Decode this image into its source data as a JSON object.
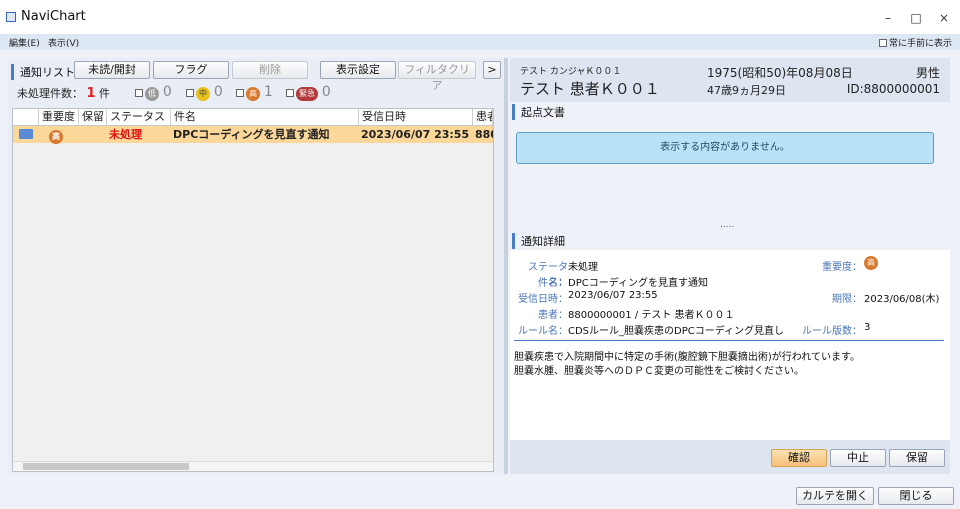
{
  "window": {
    "title": "NaviChart",
    "minimize": "–",
    "maximize": "□",
    "close": "×"
  },
  "menu": {
    "items": [
      "編集(E)",
      "表示(V)"
    ],
    "always_on_top": "常に手前に表示"
  },
  "left": {
    "title": "通知リスト",
    "buttons": {
      "unread": "未読/開封",
      "flag": "フラグ",
      "delete": "削除",
      "display_settings": "表示設定",
      "filter_clear": "フィルタクリア",
      "expand": ">"
    },
    "unprocessed_label": "未処理件数：",
    "unprocessed_count": "1",
    "unprocessed_unit": "件",
    "filters": [
      {
        "badge": "低",
        "count": "0",
        "color": "#9a9a9a"
      },
      {
        "badge": "中",
        "count": "0",
        "color": "#e8c21a"
      },
      {
        "badge": "高",
        "count": "1",
        "color": "#d9782c"
      },
      {
        "badge": "緊急",
        "count": "0",
        "color": "#b33a3a"
      }
    ],
    "columns": [
      "重要度",
      "保留",
      "ステータス",
      "件名",
      "受信日時",
      "患者"
    ],
    "rows": [
      {
        "importance": "高",
        "hold": "",
        "status": "未処理",
        "subject": "DPCコーディングを見直す通知",
        "received": "2023/06/07 23:55",
        "patient": "880"
      }
    ]
  },
  "patient": {
    "kana": "テスト カンジャＫ００１",
    "name": "テスト 患者Ｋ００１",
    "birth": "1975(昭和50)年08月08日",
    "age": "47歳9ヵ月29日",
    "sex": "男性",
    "id": "ID:8800000001"
  },
  "origin": {
    "title": "起点文書",
    "empty": "表示する内容がありません。",
    "dots": "....."
  },
  "detail": {
    "title": "通知詳細",
    "status_label": "ステータス：",
    "status": "未処理",
    "importance_label": "重要度：",
    "importance": "高",
    "subject_label": "件名：",
    "subject": "DPCコーディングを見直す通知",
    "received_label": "受信日時：",
    "received": "2023/06/07 23:55",
    "deadline_label": "期限：",
    "deadline": "2023/06/08(木)",
    "patient_label": "患者：",
    "patient": "8800000001 / テスト 患者Ｋ００１",
    "rule_label": "ルール名：",
    "rule": "CDSルール_胆嚢疾患のDPCコーディング見直し",
    "rule_ver_label": "ルール版数：",
    "rule_ver": "3",
    "message1": "胆嚢疾患で入院期間中に特定の手術(腹腔鏡下胆嚢摘出術)が行われています。",
    "message2": "胆嚢水腫、胆嚢炎等へのＤＰＣ変更の可能性をご検討ください。",
    "btn_confirm": "確認",
    "btn_cancel": "中止",
    "btn_hold": "保留"
  },
  "bottom": {
    "open_chart": "カルテを開く",
    "close": "閉じる"
  }
}
